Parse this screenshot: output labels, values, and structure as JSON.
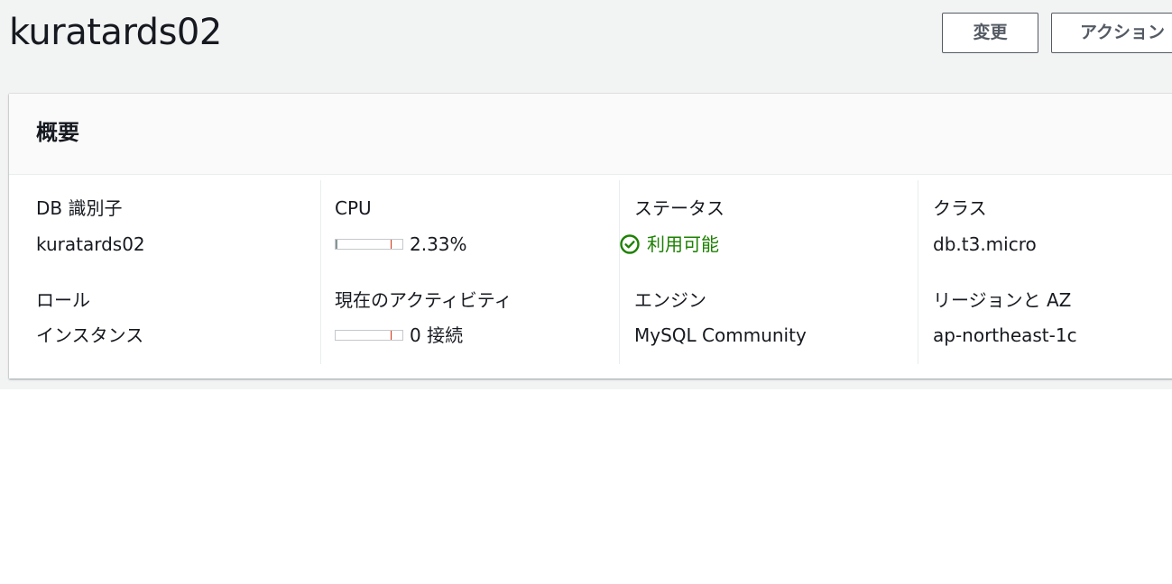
{
  "header": {
    "title": "kuratards02",
    "modify_button": "変更",
    "actions_button": "アクション"
  },
  "summary": {
    "title": "概要",
    "db_identifier_label": "DB 識別子",
    "db_identifier_value": "kuratards02",
    "role_label": "ロール",
    "role_value": "インスタンス",
    "cpu_label": "CPU",
    "cpu_value": "2.33%",
    "cpu_fraction": 0.0233,
    "activity_label": "現在のアクティビティ",
    "activity_value": "0 接続",
    "activity_fraction": 0,
    "status_label": "ステータス",
    "status_value": "利用可能",
    "status_color": "#1d8102",
    "engine_label": "エンジン",
    "engine_value": "MySQL Community",
    "class_label": "クラス",
    "class_value": "db.t3.micro",
    "region_label": "リージョンと AZ",
    "region_value": "ap-northeast-1c"
  },
  "icons": {
    "status_icon": "check-circle-icon"
  }
}
